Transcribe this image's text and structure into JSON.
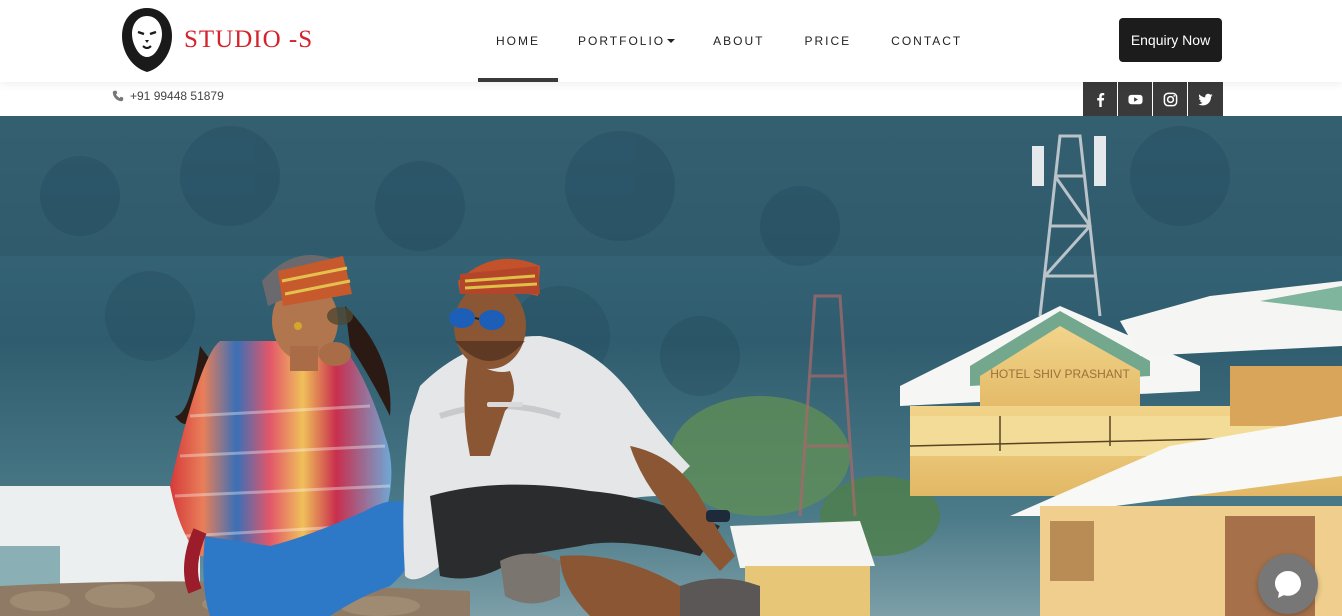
{
  "brand": {
    "name": "STUDIO -S",
    "color": "#d4232b"
  },
  "nav": {
    "items": [
      {
        "label": "HOME",
        "active": true
      },
      {
        "label": "PORTFOLIO",
        "dropdown": true
      },
      {
        "label": "ABOUT"
      },
      {
        "label": "PRICE"
      },
      {
        "label": "CONTACT"
      }
    ]
  },
  "cta": {
    "label": "Enquiry Now"
  },
  "contact": {
    "phone": "+91 99448 51879",
    "icon": "phone-icon"
  },
  "social": [
    {
      "name": "facebook",
      "icon": "facebook-icon"
    },
    {
      "name": "youtube",
      "icon": "youtube-icon"
    },
    {
      "name": "instagram",
      "icon": "instagram-icon"
    },
    {
      "name": "twitter",
      "icon": "twitter-icon"
    }
  ],
  "hero": {
    "description_icon": "hero-photo",
    "sign_text": "HOTEL SHIV PRASHANT"
  },
  "chat": {
    "icon": "chat-icon"
  },
  "colors": {
    "dark": "#1c1c1c",
    "social_bg": "#3a3a3a",
    "accent": "#d4232b"
  }
}
